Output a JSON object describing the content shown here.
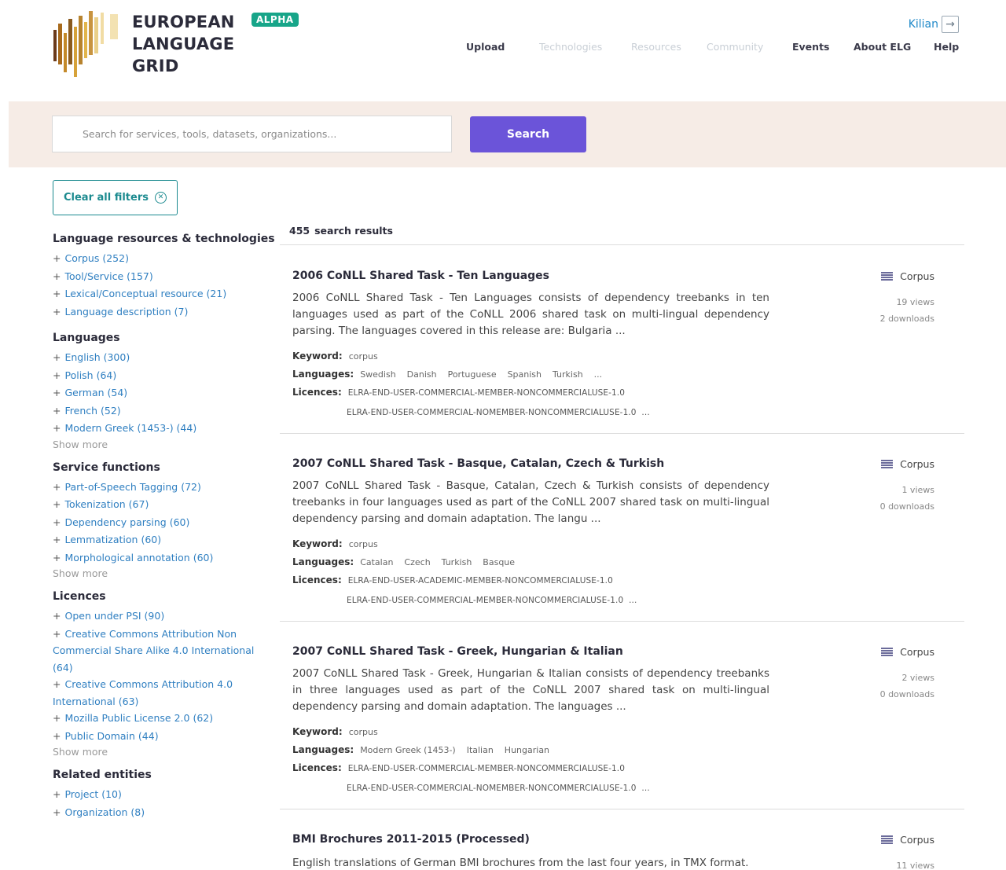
{
  "brand": {
    "line1": "EUROPEAN",
    "line2": "LANGUAGE",
    "line3": "GRID",
    "badge": "ALPHA"
  },
  "user": {
    "name": "Kilian",
    "icon": "logout-icon"
  },
  "nav": [
    {
      "label": "Upload",
      "enabled": true
    },
    {
      "label": "Technologies",
      "enabled": false
    },
    {
      "label": "Resources",
      "enabled": false
    },
    {
      "label": "Community",
      "enabled": false
    },
    {
      "label": "Events",
      "enabled": true
    },
    {
      "label": "About ELG",
      "enabled": true
    },
    {
      "label": "Help",
      "enabled": true
    }
  ],
  "search": {
    "placeholder": "Search for services, tools, datasets, organizations...",
    "button": "Search"
  },
  "clear_filters": "Clear all filters",
  "facets": {
    "lrt": {
      "title": "Language resources & technologies",
      "items": [
        "Corpus (252)",
        "Tool/Service (157)",
        "Lexical/Conceptual resource (21)",
        "Language description (7)"
      ]
    },
    "languages": {
      "title": "Languages",
      "items": [
        "English (300)",
        "Polish (64)",
        "German (54)",
        "French (52)",
        "Modern Greek (1453-) (44)"
      ],
      "show_more": "Show more"
    },
    "service_functions": {
      "title": "Service functions",
      "items": [
        "Part-of-Speech Tagging (72)",
        "Tokenization (67)",
        "Dependency parsing (60)",
        "Lemmatization (60)",
        "Morphological annotation (60)"
      ],
      "show_more": "Show more"
    },
    "licences": {
      "title": "Licences",
      "items": [
        "Open under PSI (90)",
        "Creative Commons Attribution Non Commercial Share Alike 4.0 International (64)",
        "Creative Commons Attribution 4.0 International (63)",
        "Mozilla Public License 2.0 (62)",
        "Public Domain (44)"
      ],
      "show_more": "Show more"
    },
    "related": {
      "title": "Related entities",
      "items": [
        "Project (10)",
        "Organization (8)"
      ]
    }
  },
  "results": {
    "count": "455",
    "count_label": "search results",
    "labels": {
      "keyword": "Keyword:",
      "languages": "Languages:",
      "licences": "Licences:"
    },
    "items": [
      {
        "title": "2006 CoNLL Shared Task - Ten Languages",
        "description": "2006 CoNLL Shared Task - Ten Languages consists of dependency treebanks in ten languages used as part of the CoNLL 2006 shared task on multi-lingual dependency parsing. The languages covered in this release are: Bulgaria ...",
        "keyword": "corpus",
        "languages": "Swedish    Danish    Portuguese    Spanish    Turkish    ...",
        "licence1": "ELRA-END-USER-COMMERCIAL-MEMBER-NONCOMMERCIALUSE-1.0",
        "licence2": "ELRA-END-USER-COMMERCIAL-NOMEMBER-NONCOMMERCIALUSE-1.0  ...",
        "type": "Corpus",
        "views": "19 views",
        "downloads": "2 downloads"
      },
      {
        "title": "2007 CoNLL Shared Task - Basque, Catalan, Czech & Turkish",
        "description": "2007 CoNLL Shared Task - Basque, Catalan, Czech & Turkish consists of dependency treebanks in four languages used as part of the CoNLL 2007 shared task on multi-lingual dependency parsing and domain adaptation. The langu ...",
        "keyword": "corpus",
        "languages": "Catalan    Czech    Turkish    Basque",
        "licence1": "ELRA-END-USER-ACADEMIC-MEMBER-NONCOMMERCIALUSE-1.0",
        "licence2": "ELRA-END-USER-COMMERCIAL-MEMBER-NONCOMMERCIALUSE-1.0  ...",
        "type": "Corpus",
        "views": "1 views",
        "downloads": "0 downloads"
      },
      {
        "title": "2007 CoNLL Shared Task - Greek, Hungarian & Italian",
        "description": "2007 CoNLL Shared Task - Greek, Hungarian & Italian consists of dependency treebanks in three languages used as part of the CoNLL 2007 shared task on multi-lingual dependency parsing and domain adaptation. The languages ...",
        "keyword": "corpus",
        "languages": "Modern Greek (1453-)    Italian    Hungarian",
        "licence1": "ELRA-END-USER-COMMERCIAL-MEMBER-NONCOMMERCIALUSE-1.0",
        "licence2": "ELRA-END-USER-COMMERCIAL-NOMEMBER-NONCOMMERCIALUSE-1.0  ...",
        "type": "Corpus",
        "views": "2 views",
        "downloads": "0 downloads"
      },
      {
        "title": "BMI Brochures 2011-2015 (Processed)",
        "description": "English translations of German BMI brochures from the last four years, in TMX format.",
        "type": "Corpus",
        "views": "11 views"
      }
    ]
  }
}
